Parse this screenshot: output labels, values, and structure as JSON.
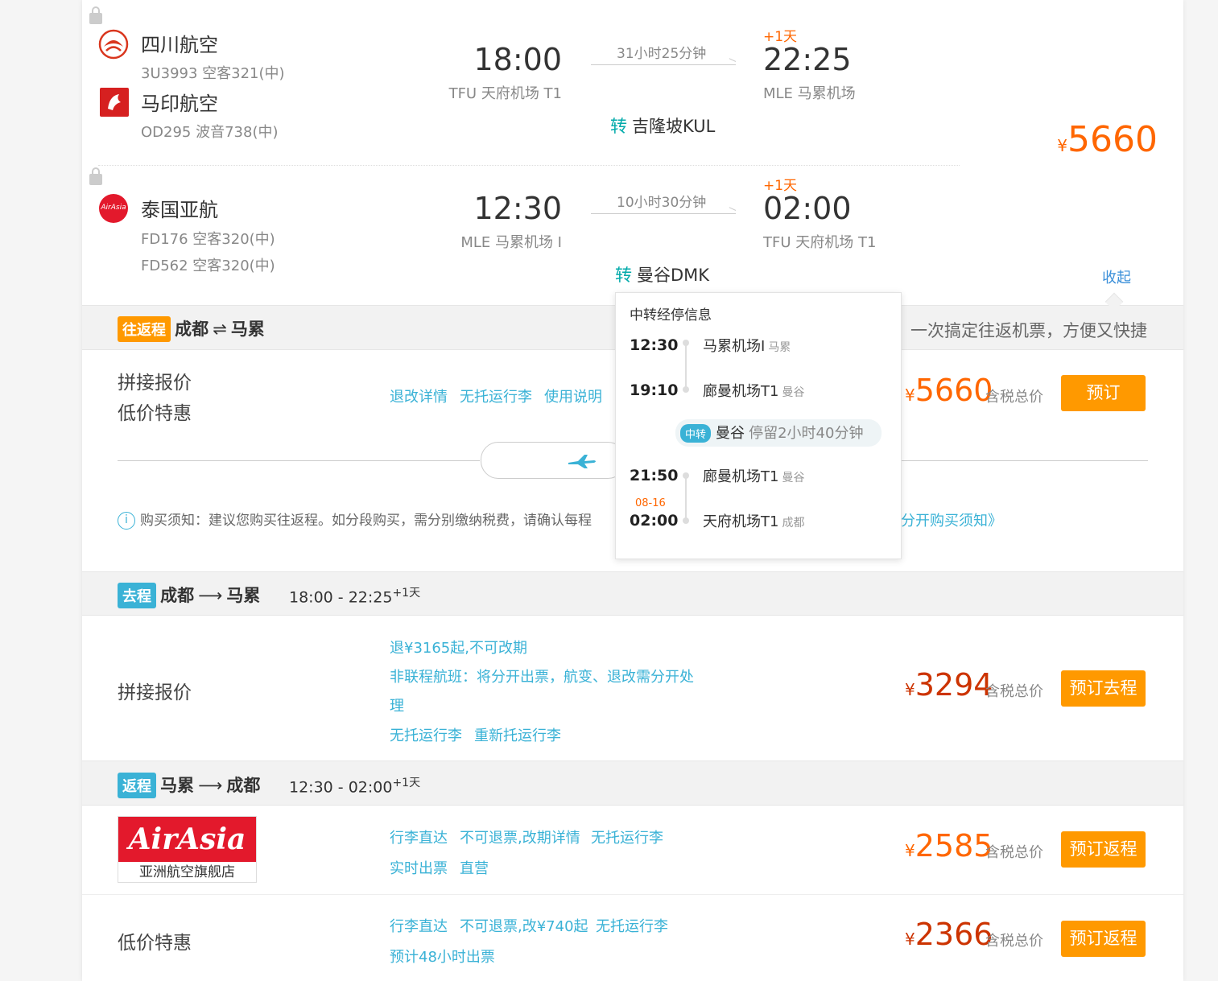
{
  "outbound": {
    "airline1": {
      "name": "四川航空",
      "flight": "3U3993 空客321(中)"
    },
    "airline2": {
      "name": "马印航空",
      "flight": "OD295 波音738(中)"
    },
    "dep_time": "18:00",
    "dep_airport": "TFU 天府机场 T1",
    "duration": "31小时25分钟",
    "plus_day": "+1天",
    "arr_time": "22:25",
    "arr_airport": "MLE 马累机场",
    "transfer_label": "转",
    "transfer_city": "吉隆坡KUL"
  },
  "inbound": {
    "airline": {
      "name": "泰国亚航",
      "flight1": "FD176 空客320(中)",
      "flight2": "FD562 空客320(中)"
    },
    "dep_time": "12:30",
    "dep_airport": "MLE 马累机场 I",
    "duration": "10小时30分钟",
    "plus_day": "+1天",
    "arr_time": "02:00",
    "arr_airport": "TFU 天府机场 T1",
    "transfer_label": "转",
    "transfer_city": "曼谷DMK"
  },
  "summary_price": {
    "currency": "¥",
    "amount": "5660"
  },
  "collapse": "收起",
  "roundtrip": {
    "tag": "往返程",
    "from": "成都",
    "arrow": "⇌",
    "to": "马累",
    "slogan": "一次搞定往返机票，方便又快捷",
    "label1": "拼接报价",
    "label2": "低价特惠",
    "links": [
      "退改详情",
      "无托运行李",
      "使用说明"
    ],
    "price": "5660",
    "currency": "¥",
    "tax": "含税总价",
    "book": "预订",
    "notice": "购买须知：建议您购买往返程。如分段购买，需分别缴纳税费，请确认每程",
    "notice_link": "分开购买须知》",
    "info_icon": "i"
  },
  "popup": {
    "title": "中转经停信息",
    "seg1_dep_time": "12:30",
    "seg1_dep_airport": "马累机场I",
    "seg1_dep_city": "马累",
    "seg1_arr_time": "19:10",
    "seg1_arr_airport": "廊曼机场T1",
    "seg1_arr_city": "曼谷",
    "stop_tag": "中转",
    "stop_city": "曼谷",
    "stop_duration": "停留2小时40分钟",
    "seg2_dep_time": "21:50",
    "seg2_dep_airport": "廊曼机场T1",
    "seg2_dep_city": "曼谷",
    "seg2_arr_date": "08-16",
    "seg2_arr_time": "02:00",
    "seg2_arr_airport": "天府机场T1",
    "seg2_arr_city": "成都"
  },
  "go": {
    "tag": "去程",
    "from": "成都",
    "arrow": "⟶",
    "to": "马累",
    "times": "18:00 - 22:25",
    "plus": "+1天",
    "label": "拼接报价",
    "link1": "退¥3165起,不可改期",
    "link2a": "非联程航班：将分开出票，航变、退改需分开处",
    "link2b": "理",
    "link3": "无托运行李",
    "link4": "重新托运行李",
    "price": "3294",
    "currency": "¥",
    "tax": "含税总价",
    "book": "预订去程"
  },
  "back": {
    "tag": "返程",
    "from": "马累",
    "arrow": "⟶",
    "to": "成都",
    "times": "12:30 - 02:00",
    "plus": "+1天",
    "shop_logo": "AirAsia",
    "shop_name": "亚洲航空旗舰店",
    "row1_links": [
      "行李直达",
      "不可退票,改期详情",
      "无托运行李"
    ],
    "row1_links2": [
      "实时出票",
      "直营"
    ],
    "row1_price": "2585",
    "row2_label": "低价特惠",
    "row2_links": [
      "行李直达",
      "不可退票,改¥740起",
      "无托运行李"
    ],
    "row2_link2": "预计48小时出票",
    "row2_price": "2366",
    "currency": "¥",
    "tax": "含税总价",
    "book": "预订返程"
  },
  "colors": {
    "accent": "#ff9900",
    "price_orange": "#ff6600",
    "price_red": "#cc3300",
    "link": "#3ab2d6"
  }
}
